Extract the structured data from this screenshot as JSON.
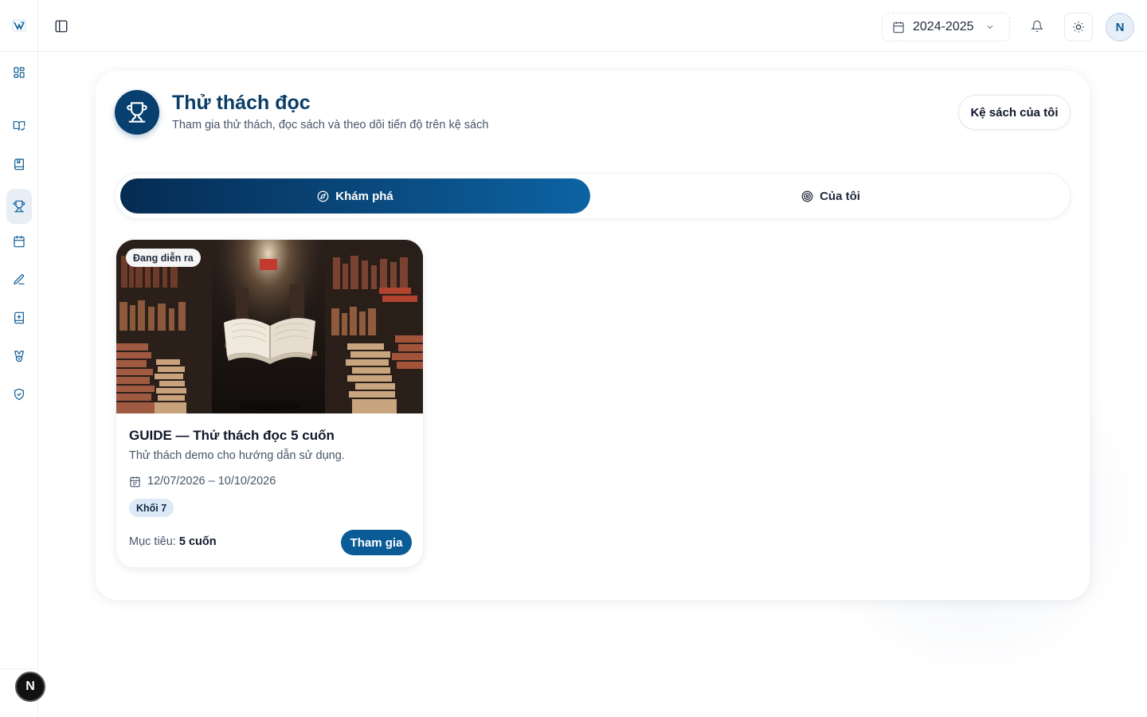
{
  "topbar": {
    "school_year": "2024-2025",
    "user_initial": "N"
  },
  "sidebar": {
    "items": [
      {
        "name": "dashboard-icon"
      },
      {
        "name": "open-book-check-icon"
      },
      {
        "name": "book-icon"
      },
      {
        "name": "trophy-icon",
        "active": true
      },
      {
        "name": "calendar-icon"
      },
      {
        "name": "pen-icon"
      },
      {
        "name": "book-plus-icon"
      },
      {
        "name": "medal-icon"
      },
      {
        "name": "shield-check-icon"
      }
    ],
    "dev_badge": "N"
  },
  "header": {
    "title": "Thử thách đọc",
    "subtitle": "Tham gia thử thách, đọc sách và theo dõi tiến độ trên kệ sách",
    "shelf_button": "Kệ sách của tôi"
  },
  "tabs": [
    {
      "label": "Khám phá",
      "icon": "compass-icon",
      "active": true
    },
    {
      "label": "Của tôi",
      "icon": "target-icon",
      "active": false
    }
  ],
  "challenges": [
    {
      "status": "Đang diễn ra",
      "title": "GUIDE — Thử thách đọc 5 cuốn",
      "description": "Thử thách demo cho hướng dẫn sử dụng.",
      "dates": "12/07/2026 – 10/10/2026",
      "grade": "Khối 7",
      "goal_label": "Mục tiêu:",
      "goal_value": "5 cuốn",
      "join_label": "Tham gia"
    }
  ],
  "colors": {
    "primary": "#0b5c96",
    "primary_dark": "#07406e",
    "title": "#0a3e68"
  }
}
